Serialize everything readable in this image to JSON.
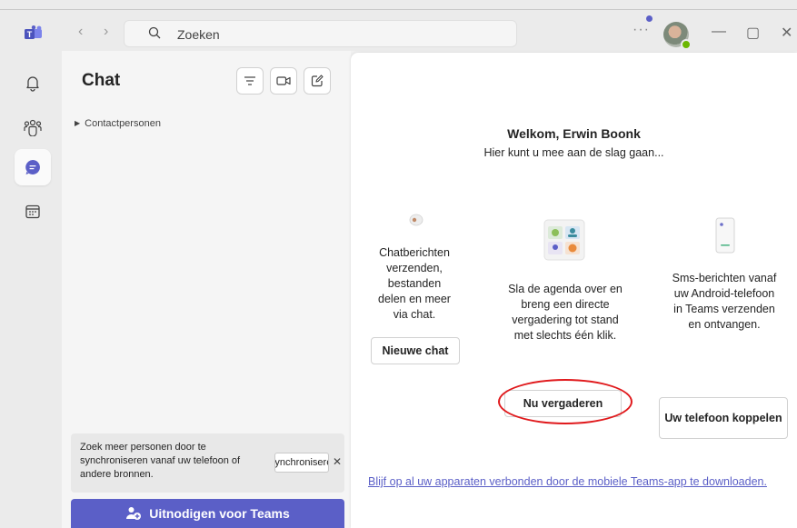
{
  "search": {
    "text": "Zoeken"
  },
  "titlebar": {
    "more": "···",
    "minimize": "—",
    "maximize": "▢",
    "close": "✕",
    "back": "‹",
    "forward": "›"
  },
  "chat": {
    "title": "Chat",
    "contacts_label": "Contactpersonen",
    "banner_text": "Zoek meer personen door te synchroniseren vanaf uw telefoon of andere bronnen.",
    "banner_button": "Synchroniseren",
    "banner_close": "✕",
    "invite_label": "Uitnodigen voor Teams"
  },
  "main": {
    "welcome": "Welkom, Erwin Boonk",
    "subtitle": "Hier kunt u mee aan de slag gaan...",
    "col1_text": "Chatberichten verzenden, bestanden delen en meer via chat.",
    "col1_button": "Nieuwe chat",
    "col2_text": "Sla de agenda over en breng een directe vergadering tot stand met slechts één klik.",
    "col2_button": "Nu vergaderen",
    "col3_text": "Sms-berichten vanaf uw Android-telefoon in Teams verzenden en ontvangen.",
    "col3_button": "Uw telefoon koppelen",
    "footer_link": "Blijf op al uw apparaten verbonden door de mobiele Teams-app te downloaden."
  },
  "colors": {
    "accent": "#5b5fc7",
    "highlight": "#e0191c",
    "presence": "#6bb700"
  },
  "icons": [
    "teams-logo-icon",
    "search-icon",
    "bell-icon",
    "people-icon",
    "chat-icon",
    "calendar-icon",
    "filter-icon",
    "video-icon",
    "compose-icon",
    "add-person-icon"
  ]
}
